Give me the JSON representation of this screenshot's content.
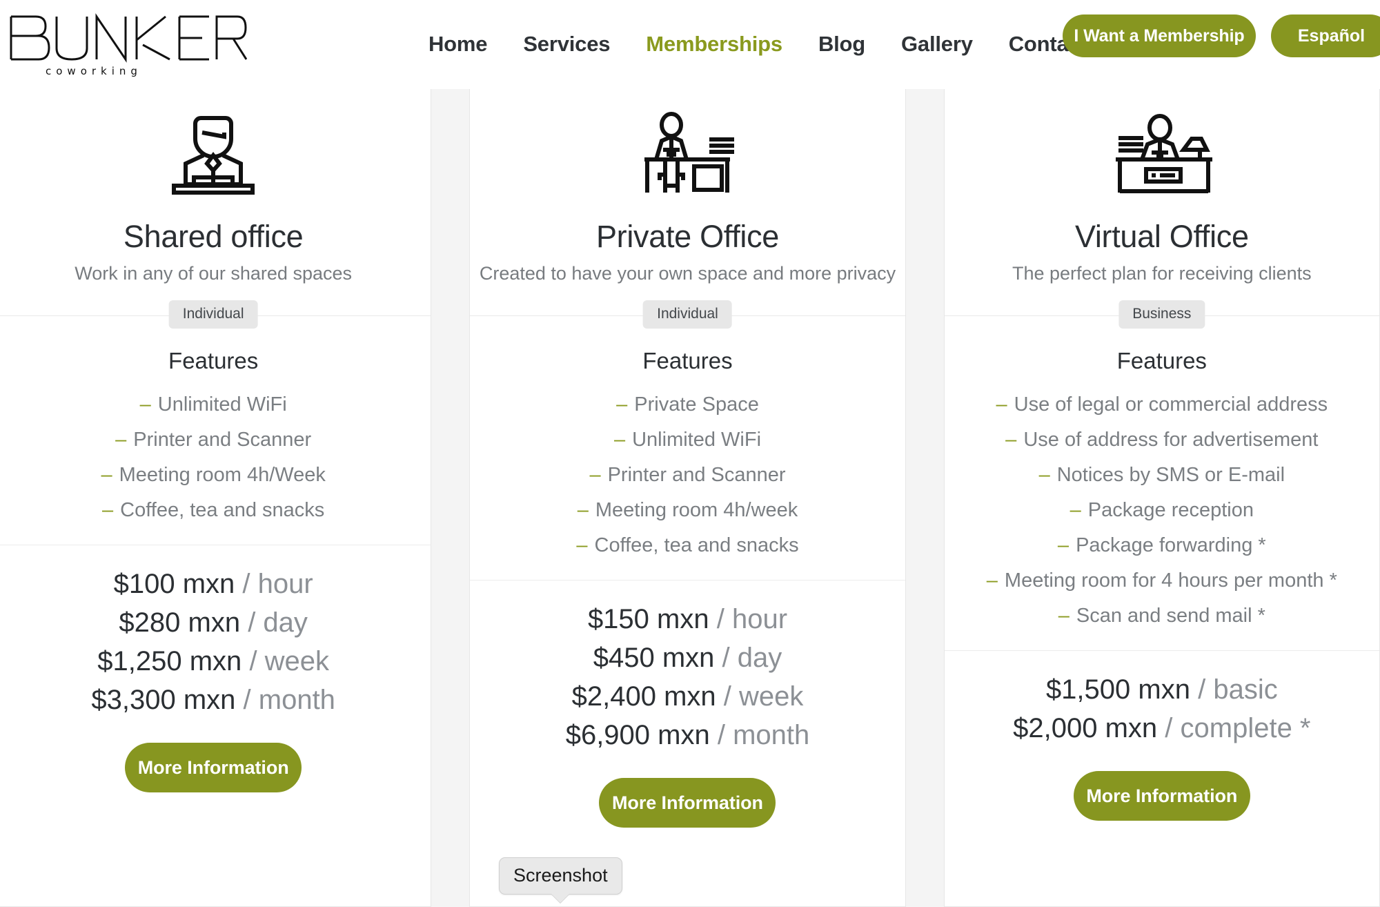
{
  "brand": {
    "name": "BUNKER",
    "tagline": "coworking"
  },
  "nav": {
    "items": [
      {
        "label": "Home",
        "active": false
      },
      {
        "label": "Services",
        "active": false
      },
      {
        "label": "Memberships",
        "active": true
      },
      {
        "label": "Blog",
        "active": false
      },
      {
        "label": "Gallery",
        "active": false
      },
      {
        "label": "Contact",
        "active": false
      }
    ],
    "cta_label": "I Want a Membership",
    "language_label": "Español"
  },
  "colors": {
    "accent_green": "#879620",
    "nav_active": "#8a9a1e",
    "text_dark": "#2b2f33",
    "text_muted": "#7a7e82",
    "page_bg": "#f4f4f4",
    "card_bg": "#ffffff",
    "badge_bg": "#e7e7e7"
  },
  "cards": [
    {
      "icon_name": "person-at-laptop-icon",
      "title": "Shared office",
      "subtitle": "Work in any of our shared spaces",
      "badge": "Individual",
      "features_title": "Features",
      "features": [
        "Unlimited WiFi",
        "Printer and Scanner",
        "Meeting room 4h/Week",
        "Coffee, tea and snacks"
      ],
      "prices": [
        {
          "amount": "$100 mxn",
          "unit": "/ hour"
        },
        {
          "amount": "$280 mxn",
          "unit": "/ day"
        },
        {
          "amount": "$1,250 mxn",
          "unit": "/ week"
        },
        {
          "amount": "$3,300 mxn",
          "unit": "/ month"
        }
      ],
      "cta_label": "More Information"
    },
    {
      "icon_name": "person-standing-at-desk-icon",
      "title": "Private Office",
      "subtitle": "Created to have your own space and more privacy",
      "badge": "Individual",
      "features_title": "Features",
      "features": [
        "Private Space",
        "Unlimited WiFi",
        "Printer and Scanner",
        "Meeting room 4h/week",
        "Coffee, tea and snacks"
      ],
      "prices": [
        {
          "amount": "$150 mxn",
          "unit": "/ hour"
        },
        {
          "amount": "$450 mxn",
          "unit": "/ day"
        },
        {
          "amount": "$2,400 mxn",
          "unit": "/ week"
        },
        {
          "amount": "$6,900 mxn",
          "unit": "/ month"
        }
      ],
      "cta_label": "More Information"
    },
    {
      "icon_name": "person-behind-desk-icon",
      "title": "Virtual Office",
      "subtitle": "The perfect plan for receiving clients",
      "badge": "Business",
      "features_title": "Features",
      "features": [
        "Use of legal or commercial address",
        "Use of address for advertisement",
        "Notices by SMS or E-mail",
        "Package reception",
        "Package forwarding *",
        "Meeting room for 4 hours per month *",
        "Scan and send mail *"
      ],
      "prices": [
        {
          "amount": "$1,500 mxn",
          "unit": "/ basic"
        },
        {
          "amount": "$2,000 mxn",
          "unit": "/ complete *"
        }
      ],
      "cta_label": "More Information"
    }
  ],
  "tooltip": {
    "label": "Screenshot"
  }
}
